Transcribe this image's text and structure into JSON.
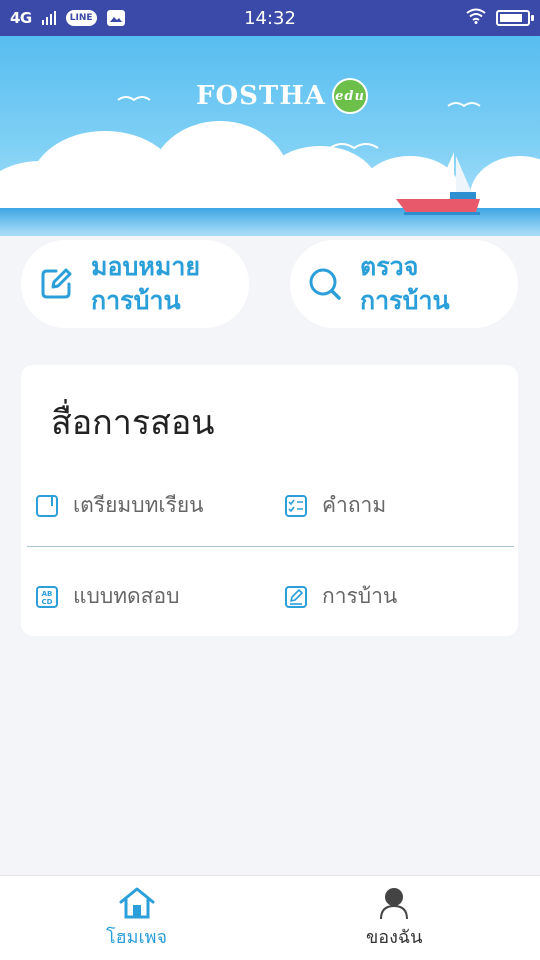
{
  "status_bar": {
    "network": "4G",
    "line_badge": "LINE",
    "time": "14:32",
    "battery_level": 0.85
  },
  "hero": {
    "logo_text": "FOSTHA",
    "logo_badge": "edu"
  },
  "actions": {
    "assign": {
      "line1": "มอบหมาย",
      "line2": "การบ้าน",
      "icon": "edit-icon"
    },
    "check": {
      "line1": "ตรวจ",
      "line2": "การบ้าน",
      "icon": "search-icon"
    }
  },
  "materials": {
    "title": "สื่อการสอน",
    "items": [
      {
        "label": "เตรียมบทเรียน",
        "icon": "lesson-plan-icon"
      },
      {
        "label": "คำถาม",
        "icon": "checklist-icon"
      },
      {
        "label": "แบบทดสอบ",
        "icon": "abcd-quiz-icon"
      },
      {
        "label": "การบ้าน",
        "icon": "homework-edit-icon"
      }
    ]
  },
  "bottom_nav": {
    "home_label": "โฮมเพจ",
    "me_label": "ของฉัน"
  },
  "colors": {
    "accent": "#2b9fd9",
    "status_bar": "#3b4aa8"
  }
}
